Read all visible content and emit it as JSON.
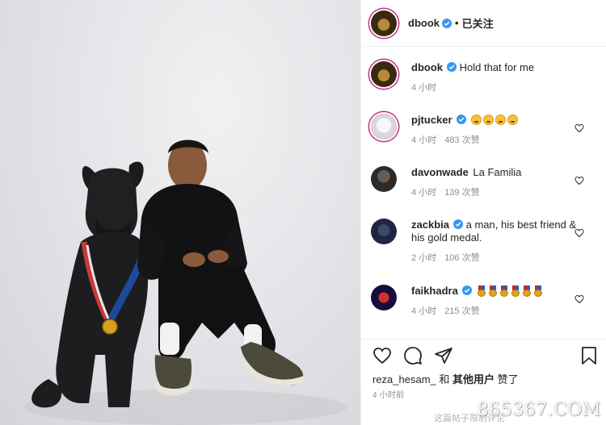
{
  "header": {
    "username": "dbook",
    "separator": "•",
    "follow_label": "已关注"
  },
  "caption": {
    "username": "dbook",
    "text": "Hold that for me",
    "time": "4 小时"
  },
  "comments": [
    {
      "username": "pjtucker",
      "verified": true,
      "text": "",
      "emojis": [
        "rofl",
        "rofl",
        "rofl",
        "rofl"
      ],
      "time": "4 小时",
      "likes": "483 次赞"
    },
    {
      "username": "davonwade",
      "verified": false,
      "text": "La Familia",
      "emojis": [],
      "time": "4 小时",
      "likes": "139 次赞"
    },
    {
      "username": "zackbia",
      "verified": true,
      "text": "a man, his best friend & his gold medal.",
      "emojis": [],
      "time": "2 小时",
      "likes": "106 次赞"
    },
    {
      "username": "faikhadra",
      "verified": true,
      "text": "",
      "emojis": [
        "medal",
        "medal",
        "medal",
        "medal",
        "medal",
        "medal"
      ],
      "time": "4 小时",
      "likes": "215 次赞"
    }
  ],
  "actions": {
    "likes_prefix": "reza_hesam_",
    "likes_and": " 和 ",
    "likes_others": "其他用户",
    "likes_suffix": " 赞了",
    "time_ago": "4 小时前",
    "comment_limit": "这篇帖子限制评论"
  },
  "watermark": "865367.COM",
  "colors": {
    "verified_blue": "#3897f0",
    "ring_gradient": "#c13584",
    "text_primary": "#262626",
    "text_secondary": "#8e8e8e"
  }
}
